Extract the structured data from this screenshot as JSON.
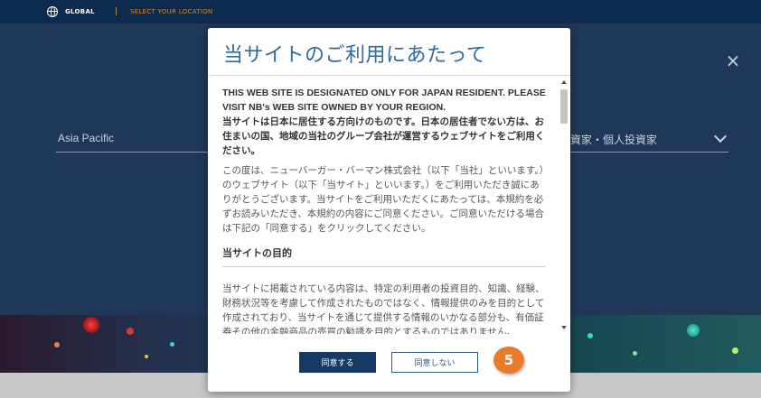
{
  "topbar": {
    "global_label": "GLOBAL",
    "separator": "|",
    "location_label": "SELECT YOUR LOCATION",
    "icon": "globe-icon"
  },
  "background": {
    "region_label": "Asia Pacific",
    "investor_label": "資家・個人投資家",
    "close_symbol": "×",
    "icons": [
      "close-icon",
      "chevron-down-icon"
    ]
  },
  "modal": {
    "title": "当サイトのご利用にあたって",
    "notice_en": "THIS WEB SITE IS DESIGNATED ONLY FOR JAPAN RESIDENT. PLEASE VISIT NB's WEB SITE OWNED BY YOUR REGION.",
    "notice_ja": "当サイトは日本に居住する方向けのものです。日本の居住者でない方は、お住まいの国、地域の当社のグループ会社が運営するウェブサイトをご利用ください。",
    "intro": "この度は、ニューバーガー・バーマン株式会社（以下「当社」といいます。）のウェブサイト（以下「当サイト」といいます。）をご利用いただき誠にありがとうございます。当サイトをご利用いただくにあたっては、本規約を必ずお読みいただき、本規約の内容にご同意ください。ご同意いただける場合は下記の「同意する」をクリックしてください。",
    "section_heading": "当サイトの目的",
    "section_body": "当サイトに掲載されている内容は、特定の利用者の投資目的、知識、経験、財務状況等を考慮して作成されたものではなく、情報提供のみを目的として作成されており、当サイトを通じて提供する情報のいかなる部分も、有価証券その他の金融商品の売買の勧誘を目的とするものではありません。",
    "agree_label": "同意する",
    "disagree_label": "同意しない"
  },
  "annotation": {
    "step_number": "5",
    "color": "#e97c2a"
  },
  "colors": {
    "topbar": "#0d2a4f",
    "background": "#1f3858",
    "accent_orange": "#e0852c",
    "title_blue": "#2c6aa0",
    "button_navy": "#163a63"
  }
}
